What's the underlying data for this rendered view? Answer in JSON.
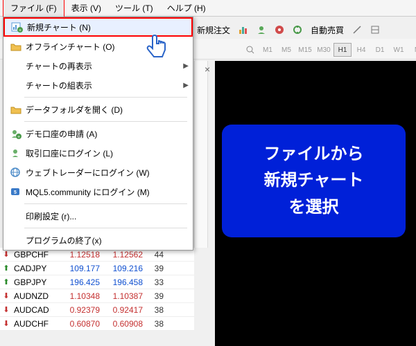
{
  "menubar": {
    "items": [
      {
        "label": "ファイル (F)"
      },
      {
        "label": "表示 (V)"
      },
      {
        "label": "ツール (T)"
      },
      {
        "label": "ヘルプ (H)"
      }
    ]
  },
  "file_menu": {
    "items": [
      {
        "icon": "new-chart-icon",
        "label": "新規チャート (N)",
        "submenu": false,
        "highlighted": true
      },
      {
        "icon": "folder-icon",
        "label": "オフラインチャート (O)",
        "submenu": false
      },
      {
        "icon": "",
        "label": "チャートの再表示",
        "submenu": true
      },
      {
        "icon": "",
        "label": "チャートの組表示",
        "submenu": true
      },
      {
        "sep": true
      },
      {
        "icon": "folder-icon",
        "label": "データフォルダを開く (D)",
        "submenu": false
      },
      {
        "sep": true
      },
      {
        "icon": "demo-icon",
        "label": "デモ口座の申請 (A)",
        "submenu": false
      },
      {
        "icon": "login-icon",
        "label": "取引口座にログイン (L)",
        "submenu": false
      },
      {
        "icon": "web-icon",
        "label": "ウェブトレーダーにログイン (W)",
        "submenu": false
      },
      {
        "icon": "mql5-icon",
        "label": "MQL5.community にログイン (M)",
        "submenu": false
      },
      {
        "sep": true
      },
      {
        "icon": "",
        "label": "印刷設定 (r)...",
        "submenu": false
      },
      {
        "sep": true
      },
      {
        "icon": "",
        "label": "プログラムの終了(x)",
        "submenu": false
      }
    ]
  },
  "toolbar": {
    "new_order": "新規注文",
    "autotrade": "自動売買"
  },
  "timeframes": {
    "items": [
      "M1",
      "M5",
      "M15",
      "M30",
      "H1",
      "H4",
      "D1",
      "W1",
      "M"
    ],
    "active": "H1"
  },
  "callout": {
    "line1": "ファイルから",
    "line2": "新規チャート",
    "line3": "を選択"
  },
  "watchlist": {
    "rows": [
      {
        "dir": "down",
        "sym": "GBPCHF",
        "bid": "1.12518",
        "ask": "1.12562",
        "spread": "44",
        "cls": "down"
      },
      {
        "dir": "up",
        "sym": "CADJPY",
        "bid": "109.177",
        "ask": "109.216",
        "spread": "39",
        "cls": "up"
      },
      {
        "dir": "up",
        "sym": "GBPJPY",
        "bid": "196.425",
        "ask": "196.458",
        "spread": "33",
        "cls": "up"
      },
      {
        "dir": "down",
        "sym": "AUDNZD",
        "bid": "1.10348",
        "ask": "1.10387",
        "spread": "39",
        "cls": "down"
      },
      {
        "dir": "down",
        "sym": "AUDCAD",
        "bid": "0.92379",
        "ask": "0.92417",
        "spread": "38",
        "cls": "down"
      },
      {
        "dir": "down",
        "sym": "AUDCHF",
        "bid": "0.60870",
        "ask": "0.60908",
        "spread": "38",
        "cls": "down"
      }
    ]
  }
}
